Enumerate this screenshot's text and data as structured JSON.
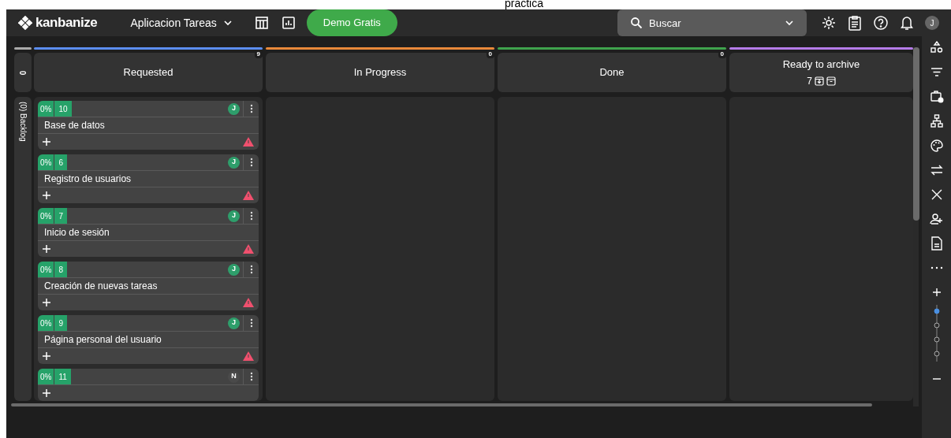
{
  "caption": "practica",
  "header": {
    "logo": "kanbanize",
    "board_name": "Aplicacion Tareas",
    "demo_button": "Demo Gratis",
    "search": {
      "placeholder": "Buscar"
    },
    "avatar": "J"
  },
  "backlog": {
    "count": "0",
    "label": "(0) Backlog"
  },
  "columns": [
    {
      "title": "Requested",
      "color": "#5b8def",
      "count": "9"
    },
    {
      "title": "In Progress",
      "color": "#e8883a",
      "count": "0"
    },
    {
      "title": "Done",
      "color": "#3fa34d",
      "count": "0"
    },
    {
      "title": "Ready to archive",
      "color": "#b57be8",
      "archived": "7"
    }
  ],
  "cards": [
    {
      "progress": "0%",
      "id": "10",
      "title": "Base de datos",
      "assignee": "J",
      "color": "#2e9e6b",
      "warning": true
    },
    {
      "progress": "0%",
      "id": "6",
      "title": "Registro de usuarios",
      "assignee": "J",
      "color": "#2e9e6b",
      "warning": true
    },
    {
      "progress": "0%",
      "id": "7",
      "title": "Inicio de sesión",
      "assignee": "J",
      "color": "#2e9e6b",
      "warning": true
    },
    {
      "progress": "0%",
      "id": "8",
      "title": "Creación de nuevas tareas",
      "assignee": "J",
      "color": "#2e9e6b",
      "warning": true
    },
    {
      "progress": "0%",
      "id": "9",
      "title": "Página personal del usuario",
      "assignee": "J",
      "color": "#2e9e6b",
      "warning": true
    },
    {
      "progress": "0%",
      "id": "11",
      "assignee": "N",
      "color": "#4a4a4a",
      "warning": false
    }
  ]
}
